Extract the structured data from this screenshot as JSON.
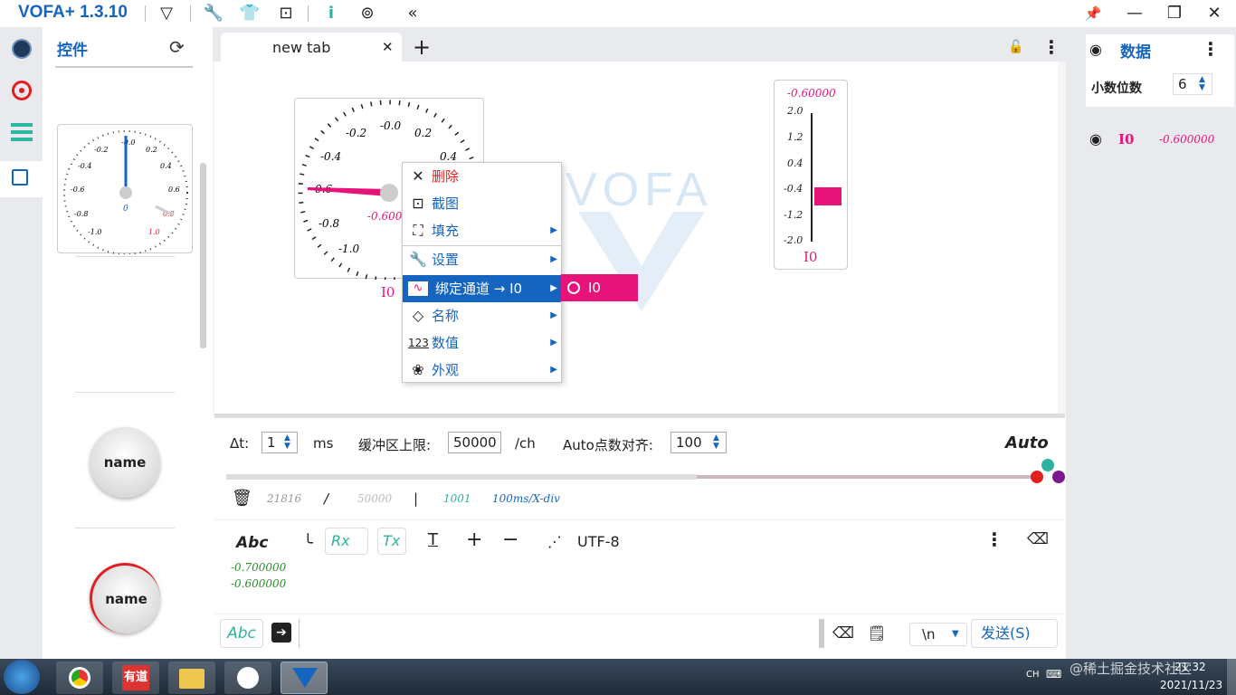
{
  "app": {
    "title": "VOFA+ 1.3.10"
  },
  "toolbar": {
    "icons": [
      "vofa-logo-icon",
      "wrench-icon",
      "shirt-icon",
      "screenshot-icon",
      "info-icon",
      "fingerprint-icon",
      "collapse-icon"
    ]
  },
  "window": {
    "pin": "pin-icon",
    "min": "—",
    "max": "❐",
    "close": "✕"
  },
  "controls": {
    "title": "控件",
    "knob1": "name",
    "knob2": "name",
    "dial": {
      "ticks": [
        "-0.0",
        "0.2",
        "0.4",
        "0.6",
        "0.8",
        "1.0",
        "-0.2",
        "-0.4",
        "-0.6",
        "-0.8",
        "-1.0"
      ],
      "center": "0"
    }
  },
  "tab": {
    "name": "new tab",
    "close": "✕",
    "add": "+"
  },
  "gauge": {
    "ticks": [
      "-0.0",
      "0.2",
      "0.4",
      "-0.2",
      "-0.4",
      "-0.6",
      "-0.8",
      "-1.0"
    ],
    "value": "-0.6000",
    "label": "I0"
  },
  "bar": {
    "value": "-0.60000",
    "ticks": [
      "2.0",
      "1.2",
      "0.4",
      "-0.4",
      "-1.2",
      "-2.0"
    ],
    "label": "I0",
    "level": 0.35
  },
  "watermark": "VOFA",
  "menu": {
    "items": [
      {
        "label": "删除",
        "icon": "✕",
        "arrow": ""
      },
      {
        "label": "截图",
        "icon": "⊡",
        "arrow": ""
      },
      {
        "label": "填充",
        "icon": "⛶",
        "arrow": "▶"
      },
      {
        "label": "设置",
        "icon": "🔧",
        "arrow": "▶"
      },
      {
        "label": "绑定通道 → I0",
        "icon": "∿",
        "arrow": "▶"
      },
      {
        "label": "名称",
        "icon": "◇",
        "arrow": "▶"
      },
      {
        "label": "数值",
        "icon": "123",
        "arrow": "▶"
      },
      {
        "label": "外观",
        "icon": "❀",
        "arrow": "▶"
      }
    ],
    "submenu": "I0"
  },
  "params": {
    "dt_label": "Δt:",
    "dt": "1",
    "ms": "ms",
    "buf_label": "缓冲区上限:",
    "buf": "50000",
    "ch": "/ch",
    "auto_label": "Auto点数对齐:",
    "auto": "100",
    "mode": "Auto"
  },
  "stats": {
    "a": "21816",
    "slash": "/",
    "b": "50000",
    "bar": "|",
    "c": "1001",
    "d": "100ms/X-div"
  },
  "console": {
    "abc": "Abc",
    "rx": "Rx",
    "tx": "Tx",
    "enc": "UTF-8",
    "lines": [
      "-0.700000",
      "-0.600000"
    ]
  },
  "send": {
    "abc": "Abc",
    "newline": "\\n",
    "send": "发送(S)"
  },
  "data": {
    "title": "数据",
    "decimals_label": "小数位数",
    "decimals": "6",
    "ch_name": "I0",
    "ch_value": "-0.600000"
  },
  "taskbar": {
    "lang": "CH",
    "time": "21:32",
    "date": "2021/11/23",
    "watermark": "@稀土掘金技术社区",
    "youdao": "有道"
  }
}
